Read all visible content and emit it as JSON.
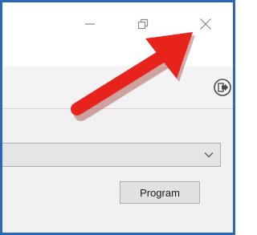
{
  "window": {
    "controls": {
      "minimize_icon": "minimize-icon",
      "restore_icon": "restore-icon",
      "close_icon": "close-icon"
    },
    "border_color": "#2d68b8"
  },
  "toolbar": {
    "exit_icon": "exit-icon"
  },
  "content": {
    "dropdown": {
      "selected_value": "",
      "icon": "chevron-down-icon"
    },
    "program_button_label": "Program"
  },
  "annotation": {
    "arrow_color": "#e8231b",
    "points_to": "close-button"
  }
}
